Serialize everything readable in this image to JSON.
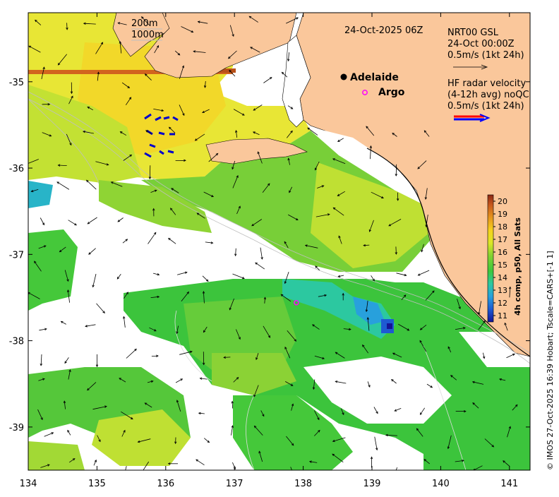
{
  "map": {
    "timestamp": "24-Oct-2025 06Z",
    "isobath_labels": [
      "200m",
      "1000m"
    ],
    "places": [
      {
        "name": "Adelaide",
        "marker": "filled-circle",
        "lon": 138.6,
        "lat": -34.93
      },
      {
        "name": "Argo",
        "marker": "open-circle-magenta",
        "lon": 138.8,
        "lat": -35.12
      }
    ],
    "argo_float_position": {
      "lon": 137.9,
      "lat": -37.56
    },
    "x_axis": {
      "min": 134,
      "max": 141.3,
      "ticks": [
        "134",
        "135",
        "136",
        "137",
        "138",
        "139",
        "140",
        "141"
      ]
    },
    "y_axis": {
      "min": -39.5,
      "max": -34.2,
      "ticks": [
        "-35",
        "-36",
        "-37",
        "-38",
        "-39"
      ]
    },
    "gsl_legend": {
      "line1": "NRT00 GSL",
      "line2": "24-Oct 00:00Z",
      "line3": "0.5m/s (1kt 24h)"
    },
    "radar_legend": {
      "line1": "HF radar velocity",
      "line2": "(4-12h avg) noQC",
      "line3": "0.5m/s (1kt 24h)"
    },
    "colorbar": {
      "title": "4h comp, p50, All Sats",
      "min": 11,
      "max": 20,
      "ticks": [
        "11",
        "12",
        "13",
        "14",
        "15",
        "16",
        "17",
        "18",
        "19",
        "20"
      ],
      "colors": [
        "#141496",
        "#1e5ad2",
        "#28a0dc",
        "#2cc8a0",
        "#3cc83c",
        "#82d232",
        "#dce628",
        "#f5d21e",
        "#e6961e",
        "#c85a1e",
        "#8c2814"
      ]
    },
    "colors": {
      "land": "#fac79b",
      "no_data": "#ffffff",
      "arrow": "#000000",
      "radar_red": "#ff0000",
      "radar_blue": "#0000ff",
      "argo": "#ff00ff"
    },
    "copyright": "© IMOS 27-Oct-2025 16:39 Hobart; Tscale=CARS+[-1 1]"
  }
}
